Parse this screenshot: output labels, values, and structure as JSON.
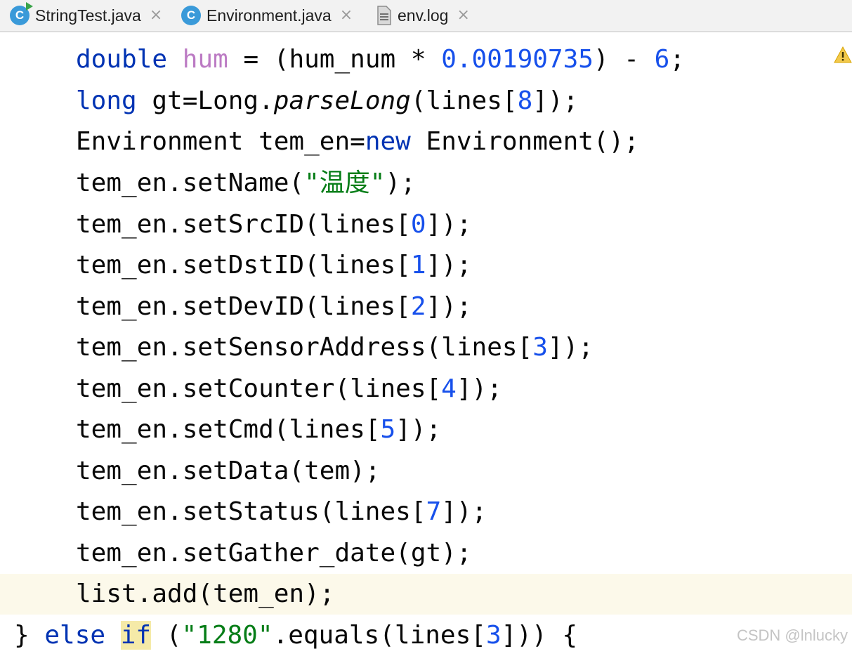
{
  "tabs": [
    {
      "label": "StringTest.java",
      "icon": "java-class-run-icon",
      "close": "×"
    },
    {
      "label": "Environment.java",
      "icon": "java-class-icon",
      "close": "×"
    },
    {
      "label": "env.log",
      "icon": "text-file-icon",
      "close": "×"
    }
  ],
  "code": {
    "line1": {
      "kw": "double",
      "var": "hum",
      "mid": " = (hum_num * ",
      "num1": "0.00190735",
      "op": ") - ",
      "num2": "6",
      "end": ";"
    },
    "line2": {
      "kw": "long",
      "a": " gt=Long.",
      "method": "parseLong",
      "b": "(lines[",
      "num": "8",
      "c": "]);"
    },
    "line3": {
      "a": "Environment tem_en=",
      "kw": "new",
      "b": " Environment();"
    },
    "line4": {
      "a": "tem_en.setName(",
      "str": "\"温度\"",
      "b": ");"
    },
    "line5": {
      "a": "tem_en.setSrcID(lines[",
      "num": "0",
      "b": "]);"
    },
    "line6": {
      "a": "tem_en.setDstID(lines[",
      "num": "1",
      "b": "]);"
    },
    "line7": {
      "a": "tem_en.setDevID(lines[",
      "num": "2",
      "b": "]);"
    },
    "line8": {
      "a": "tem_en.setSensorAddress(lines[",
      "num": "3",
      "b": "]);"
    },
    "line9": {
      "a": "tem_en.setCounter(lines[",
      "num": "4",
      "b": "]);"
    },
    "line10": {
      "a": "tem_en.setCmd(lines[",
      "num": "5",
      "b": "]);"
    },
    "line11": {
      "text": "tem_en.setData(tem);"
    },
    "line12": {
      "a": "tem_en.setStatus(lines[",
      "num": "7",
      "b": "]);"
    },
    "line13": {
      "text": "tem_en.setGather_date(gt);"
    },
    "line14": {
      "text": "list.add(tem_en);"
    },
    "line15": {
      "a": "} ",
      "kw1": "else",
      "sp": " ",
      "kw2": "if",
      "b": " (",
      "str": "\"1280\"",
      "c": ".equals(lines[",
      "num": "3",
      "d": "])) {"
    }
  },
  "watermark": "CSDN @lnlucky",
  "colors": {
    "keyword": "#0033b3",
    "number": "#1750eb",
    "string": "#067d17",
    "current_line": "#fcf9ea",
    "warning": "#f2c94c"
  }
}
